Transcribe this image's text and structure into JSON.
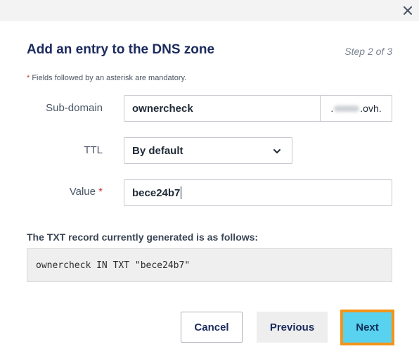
{
  "dialog": {
    "title": "Add an entry to the DNS zone",
    "step": "Step 2 of 3",
    "mandatory_note_asterisk": "*",
    "mandatory_note": " Fields followed by an asterisk are mandatory.",
    "close_icon": "close-icon"
  },
  "form": {
    "subdomain": {
      "label": "Sub-domain",
      "value": "ownercheck",
      "suffix_prefix": ".",
      "suffix_end": ".ovh."
    },
    "ttl": {
      "label": "TTL",
      "selected": "By default"
    },
    "value": {
      "label": "Value",
      "required_marker": "*",
      "value": "bece24b7"
    }
  },
  "record": {
    "heading": "The TXT record currently generated is as follows:",
    "text": "ownercheck IN TXT \"bece24b7\""
  },
  "buttons": {
    "cancel": "Cancel",
    "previous": "Previous",
    "next": "Next"
  },
  "colors": {
    "title": "#1b2a5e",
    "next_bg": "#59d2f0",
    "highlight": "#f39419",
    "required": "#c0392b"
  }
}
